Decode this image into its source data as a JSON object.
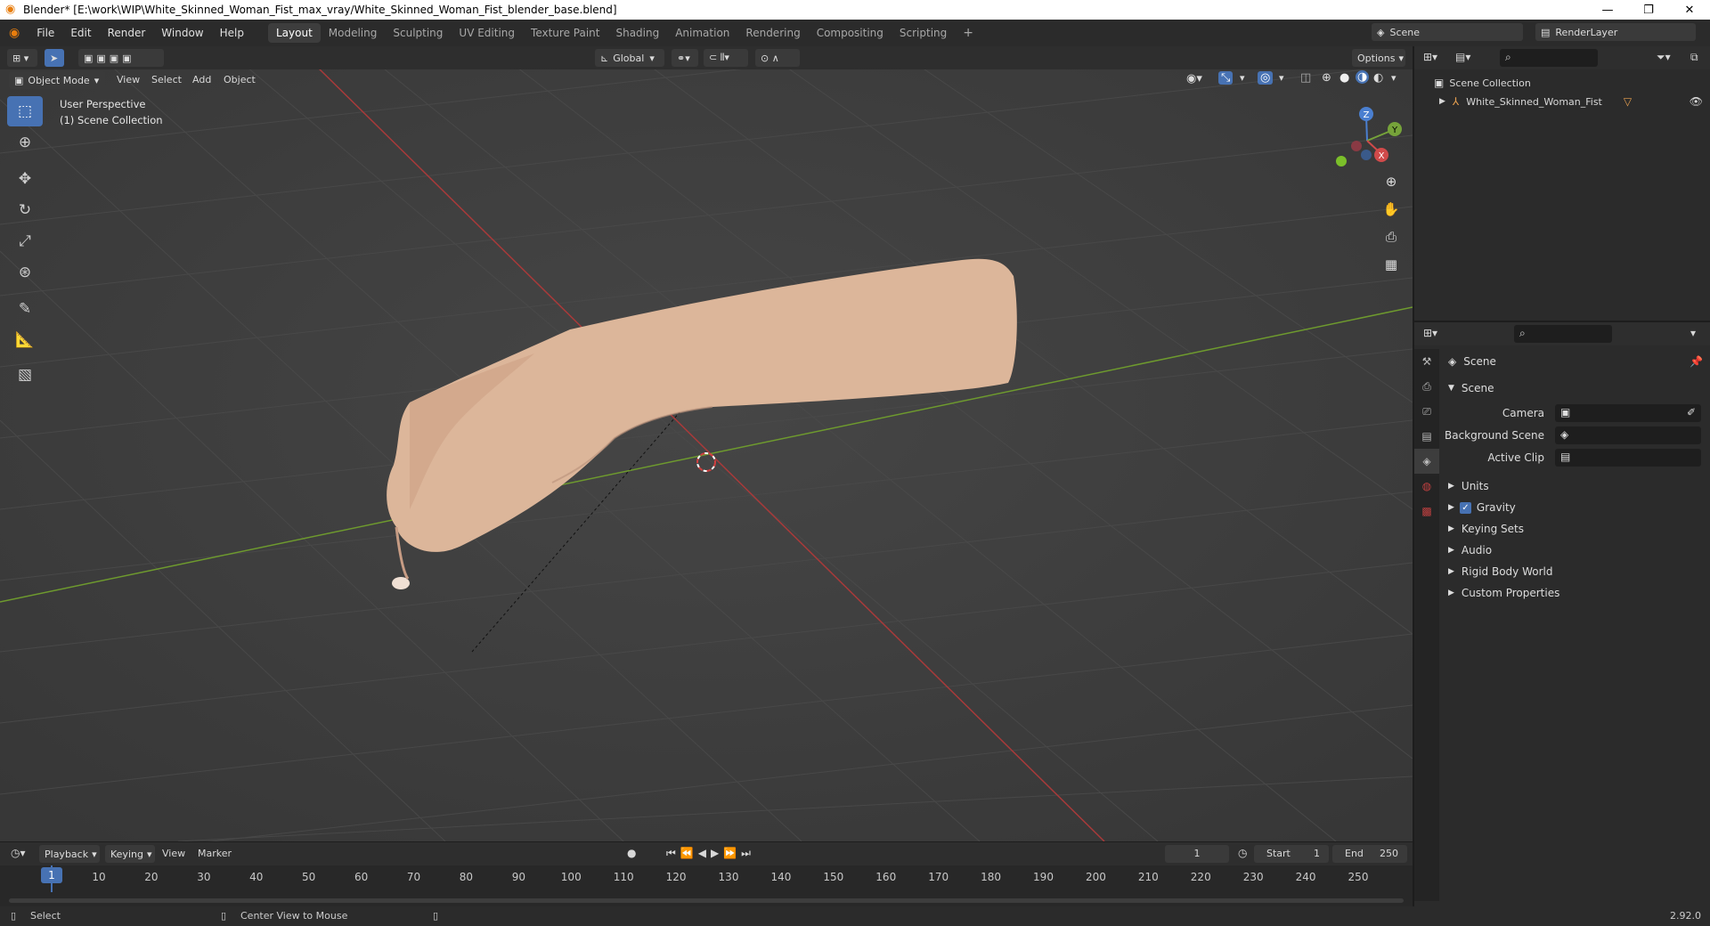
{
  "window": {
    "title": "Blender* [E:\\work\\WIP\\White_Skinned_Woman_Fist_max_vray/White_Skinned_Woman_Fist_blender_base.blend]",
    "minimize": "—",
    "maximize": "❐",
    "close": "✕"
  },
  "menus": [
    "File",
    "Edit",
    "Render",
    "Window",
    "Help"
  ],
  "workspaces": [
    "Layout",
    "Modeling",
    "Sculpting",
    "UV Editing",
    "Texture Paint",
    "Shading",
    "Animation",
    "Rendering",
    "Compositing",
    "Scripting"
  ],
  "workspace_add": "+",
  "scene_selector": {
    "scene": "Scene",
    "view_layer": "RenderLayer"
  },
  "viewport_header": {
    "transform_orientation": "Global",
    "options": "Options",
    "mode": "Object Mode",
    "menus": [
      "View",
      "Select",
      "Add",
      "Object"
    ]
  },
  "viewport": {
    "overlay_line1": "User Perspective",
    "overlay_line2": "(1) Scene Collection",
    "gizmo_axes": {
      "x": "X",
      "y": "Y",
      "z": "Z"
    }
  },
  "outliner": {
    "root": "Scene Collection",
    "items": [
      {
        "label": "White_Skinned_Woman_Fist"
      }
    ]
  },
  "properties": {
    "context": "Scene",
    "panel_title": "Scene",
    "fields": [
      {
        "label": "Camera"
      },
      {
        "label": "Background Scene"
      },
      {
        "label": "Active Clip"
      }
    ],
    "subpanels": [
      "Units",
      "Gravity",
      "Keying Sets",
      "Audio",
      "Rigid Body World",
      "Custom Properties"
    ],
    "gravity_checked": true
  },
  "timeline": {
    "menus": [
      "Playback",
      "Keying",
      "View",
      "Marker"
    ],
    "current_frame": "1",
    "start_label": "Start",
    "start": "1",
    "end_label": "End",
    "end": "250",
    "ticks": [
      "1",
      "10",
      "20",
      "30",
      "40",
      "50",
      "60",
      "70",
      "80",
      "90",
      "100",
      "110",
      "120",
      "130",
      "140",
      "150",
      "160",
      "170",
      "180",
      "190",
      "200",
      "210",
      "220",
      "230",
      "240",
      "250"
    ]
  },
  "statusbar": {
    "left": "Select",
    "middle": "Center View to Mouse",
    "version": "2.92.0"
  },
  "colors": {
    "accent": "#4772b3",
    "x_axis": "#c33a3a",
    "y_axis": "#6e9a2e",
    "blender_orange": "#e87d0d"
  }
}
